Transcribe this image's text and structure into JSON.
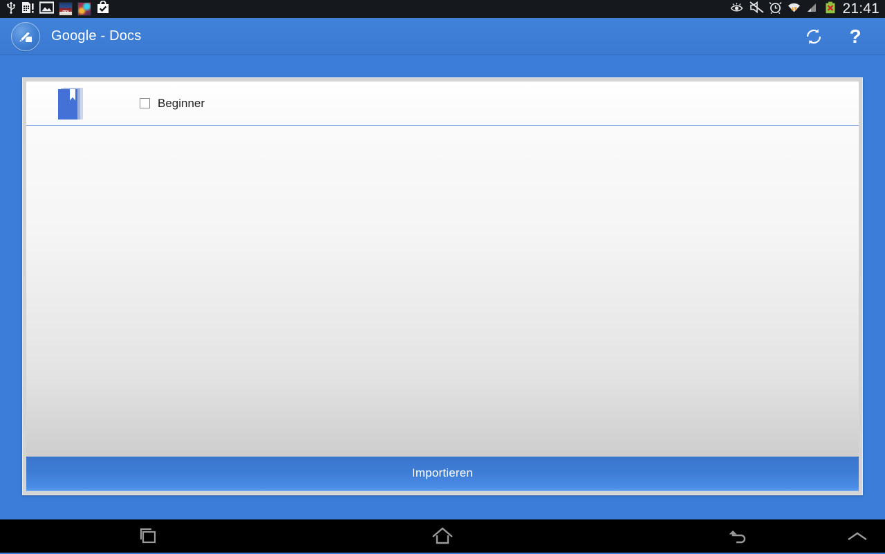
{
  "status_bar": {
    "time": "21:41",
    "left_icons": [
      {
        "name": "usb-icon",
        "label": "USB connected"
      },
      {
        "name": "sd-card-warning-icon",
        "label": "Storage notification"
      },
      {
        "name": "gallery-image-icon",
        "label": "Screenshot captured"
      },
      {
        "name": "fifa-app-icon",
        "label": "FIFA game notification"
      },
      {
        "name": "game-app-icon",
        "label": "Game notification"
      },
      {
        "name": "play-store-icon",
        "label": "App installed"
      }
    ],
    "right_icons": [
      {
        "name": "smart-stay-eye-icon",
        "label": "Smart stay"
      },
      {
        "name": "sound-muted-icon",
        "label": "Sound muted"
      },
      {
        "name": "alarm-clock-icon",
        "label": "Alarm set"
      },
      {
        "name": "wifi-icon",
        "label": "Wi-Fi connected"
      },
      {
        "name": "signal-bars-icon",
        "label": "Mobile signal"
      },
      {
        "name": "battery-error-icon",
        "label": "Battery not charging"
      }
    ]
  },
  "action_bar": {
    "title": "Google - Docs",
    "logo_name": "app-logo-pen-icon",
    "refresh_label": "Aktualisieren",
    "help_label": "?",
    "accent_color": "#3b7dd8"
  },
  "main": {
    "list": [
      {
        "icon": "book-icon",
        "label": "Beginner",
        "checked": false
      }
    ],
    "import_button_label": "Importieren"
  },
  "nav_bar": {
    "recents_label": "Recent apps",
    "home_label": "Home",
    "back_label": "Back",
    "expand_label": "Show navigation"
  }
}
